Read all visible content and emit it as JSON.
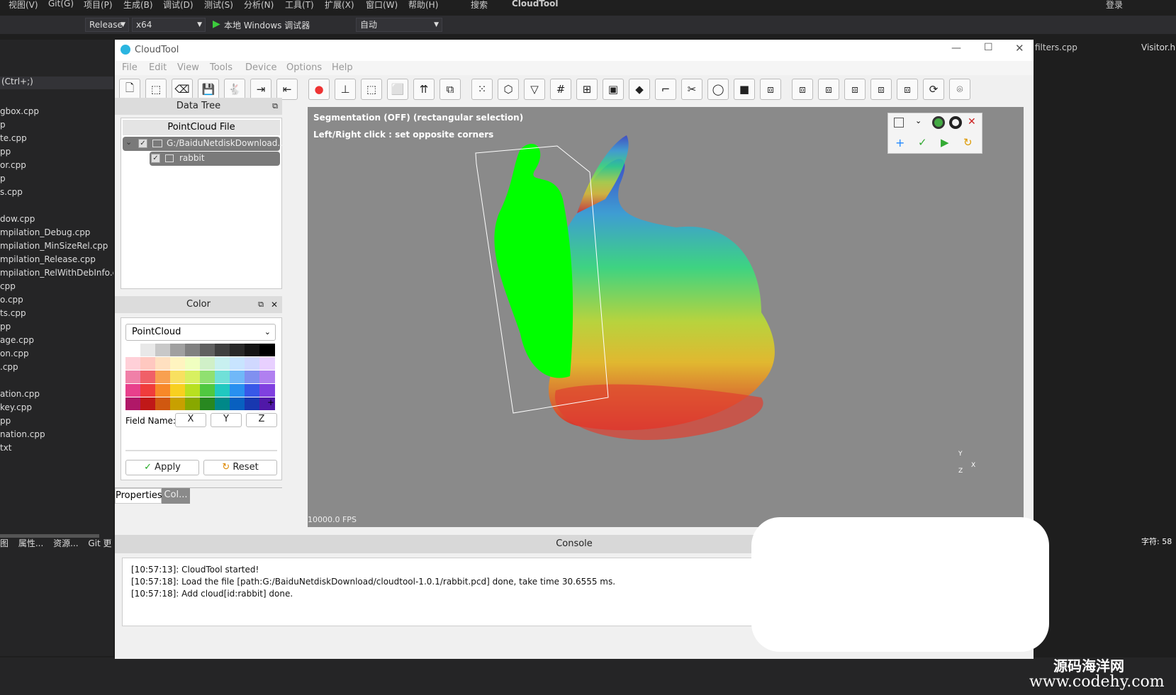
{
  "vs": {
    "menu": [
      "视图(V)",
      "Git(G)",
      "项目(P)",
      "生成(B)",
      "调试(D)",
      "测试(S)",
      "分析(N)",
      "工具(T)",
      "扩展(X)",
      "窗口(W)",
      "帮助(H)",
      "搜索",
      "CloudTool",
      "登录"
    ],
    "config": "Release",
    "platform": "x64",
    "debugger": "本地 Windows 调试器",
    "mode": "自动",
    "search_hint": "(Ctrl+;)",
    "files": [
      "gbox.cpp",
      "p",
      "te.cpp",
      "pp",
      "or.cpp",
      "p",
      "s.cpp",
      "",
      "dow.cpp",
      "mpilation_Debug.cpp",
      "mpilation_MinSizeRel.cpp",
      "mpilation_Release.cpp",
      "mpilation_RelWithDebInfo.cpp",
      "cpp",
      "o.cpp",
      "ts.cpp",
      "pp",
      "age.cpp",
      "on.cpp",
      ".cpp",
      "",
      "ation.cpp",
      "key.cpp",
      "pp",
      "nation.cpp",
      "txt"
    ],
    "bottom_tabs": [
      "图",
      "属性...",
      "资源...",
      "Git 更"
    ],
    "right_tabs": [
      "filters.cpp",
      "Visitor.h"
    ],
    "status": "字符: 58",
    "watermark_cn": "源码海洋网",
    "watermark_url": "www.codehy.com"
  },
  "app": {
    "title": "CloudTool",
    "menu": [
      "File",
      "Edit",
      "View",
      "Tools",
      "Device",
      "Options",
      "Help"
    ],
    "toolbar_icons": [
      "new-file",
      "select",
      "clear",
      "save",
      "rabbit",
      "import",
      "export",
      "color-wheel",
      "axis",
      "bbox",
      "cube-outline",
      "arrows-up",
      "copy",
      "points",
      "mesh",
      "filter",
      "grid",
      "grid-small",
      "image",
      "solid-cube",
      "corner",
      "scissors",
      "circle",
      "black-square",
      "view-front",
      "view-back",
      "view-left",
      "view-right",
      "view-top",
      "view-bottom",
      "rotate",
      "screenshot"
    ],
    "data_tree": {
      "title": "Data Tree",
      "column": "PointCloud File",
      "path": "G:/BaiduNetdiskDownload...",
      "child": "rabbit"
    },
    "color": {
      "title": "Color",
      "select": "PointCloud",
      "field_label": "Field Name:",
      "fields": [
        "X",
        "Y",
        "Z"
      ],
      "apply": "Apply",
      "reset": "Reset",
      "plus": "+",
      "rows": [
        [
          "#ffffff",
          "#e8e8e8",
          "#c8c8c8",
          "#a0a0a0",
          "#808080",
          "#606060",
          "#404040",
          "#282828",
          "#141414",
          "#000000"
        ],
        [
          "#ffd0d8",
          "#ffc8c0",
          "#ffe0c0",
          "#fff4c0",
          "#f0ffc0",
          "#d0f0c8",
          "#c8f0f0",
          "#c8e4ff",
          "#d0d8ff",
          "#e8d0ff"
        ],
        [
          "#f080a8",
          "#f06068",
          "#f8a050",
          "#f8e060",
          "#d8f060",
          "#90e070",
          "#70e0d8",
          "#70b8f8",
          "#8090f0",
          "#b080f0"
        ],
        [
          "#e8408c",
          "#f03c3c",
          "#f88828",
          "#f8d020",
          "#b8e020",
          "#50c840",
          "#20c8c0",
          "#2890f0",
          "#3858e8",
          "#8040e0"
        ],
        [
          "#b01868",
          "#c01818",
          "#d05810",
          "#c8a000",
          "#88a800",
          "#288820",
          "#008888",
          "#0860c0",
          "#1838b0",
          "#5018a8"
        ]
      ]
    },
    "tabs": [
      "Properties",
      "Col..."
    ],
    "viewer": {
      "line1": "Segmentation (OFF) (rectangular selection)",
      "line2": "Left/Right click : set opposite corners",
      "fps": "10000.0 FPS",
      "axis_x": "X",
      "axis_y": "Y",
      "axis_z": "Z"
    },
    "console": {
      "title": "Console",
      "lines": [
        "[10:57:13]: CloudTool started!",
        "[10:57:18]: Load the file [path:G:/BaiduNetdiskDownload/cloudtool-1.0.1/rabbit.pcd] done, take time 30.6555 ms.",
        "[10:57:18]: Add cloud[id:rabbit] done."
      ]
    }
  }
}
